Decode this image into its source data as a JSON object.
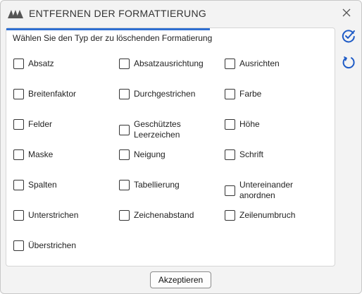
{
  "window": {
    "title": "ENTFERNEN DER FORMATTIERUNG",
    "accent_color": "#2f6fd1"
  },
  "panel": {
    "instruction": "Wählen Sie den Typ der zu löschenden Formatierung",
    "progress_fraction": 0.62
  },
  "options": [
    [
      "Absatz",
      "Absatzausrichtung",
      "Ausrichten"
    ],
    [
      "Breitenfaktor",
      "Durchgestrichen",
      "Farbe"
    ],
    [
      "Felder",
      "Geschütztes\nLeerzeichen",
      "Höhe"
    ],
    [
      "Maske",
      "Neigung",
      "Schrift"
    ],
    [
      "Spalten",
      "Tabellierung",
      "Untereinander\nanordnen"
    ],
    [
      "Unterstrichen",
      "Zeichenabstand",
      "Zeilenumbruch"
    ],
    [
      "Überstrichen"
    ]
  ],
  "side_icons": [
    "check-circle-icon",
    "refresh-circle-icon"
  ],
  "footer": {
    "accept_label": "Akzeptieren"
  }
}
